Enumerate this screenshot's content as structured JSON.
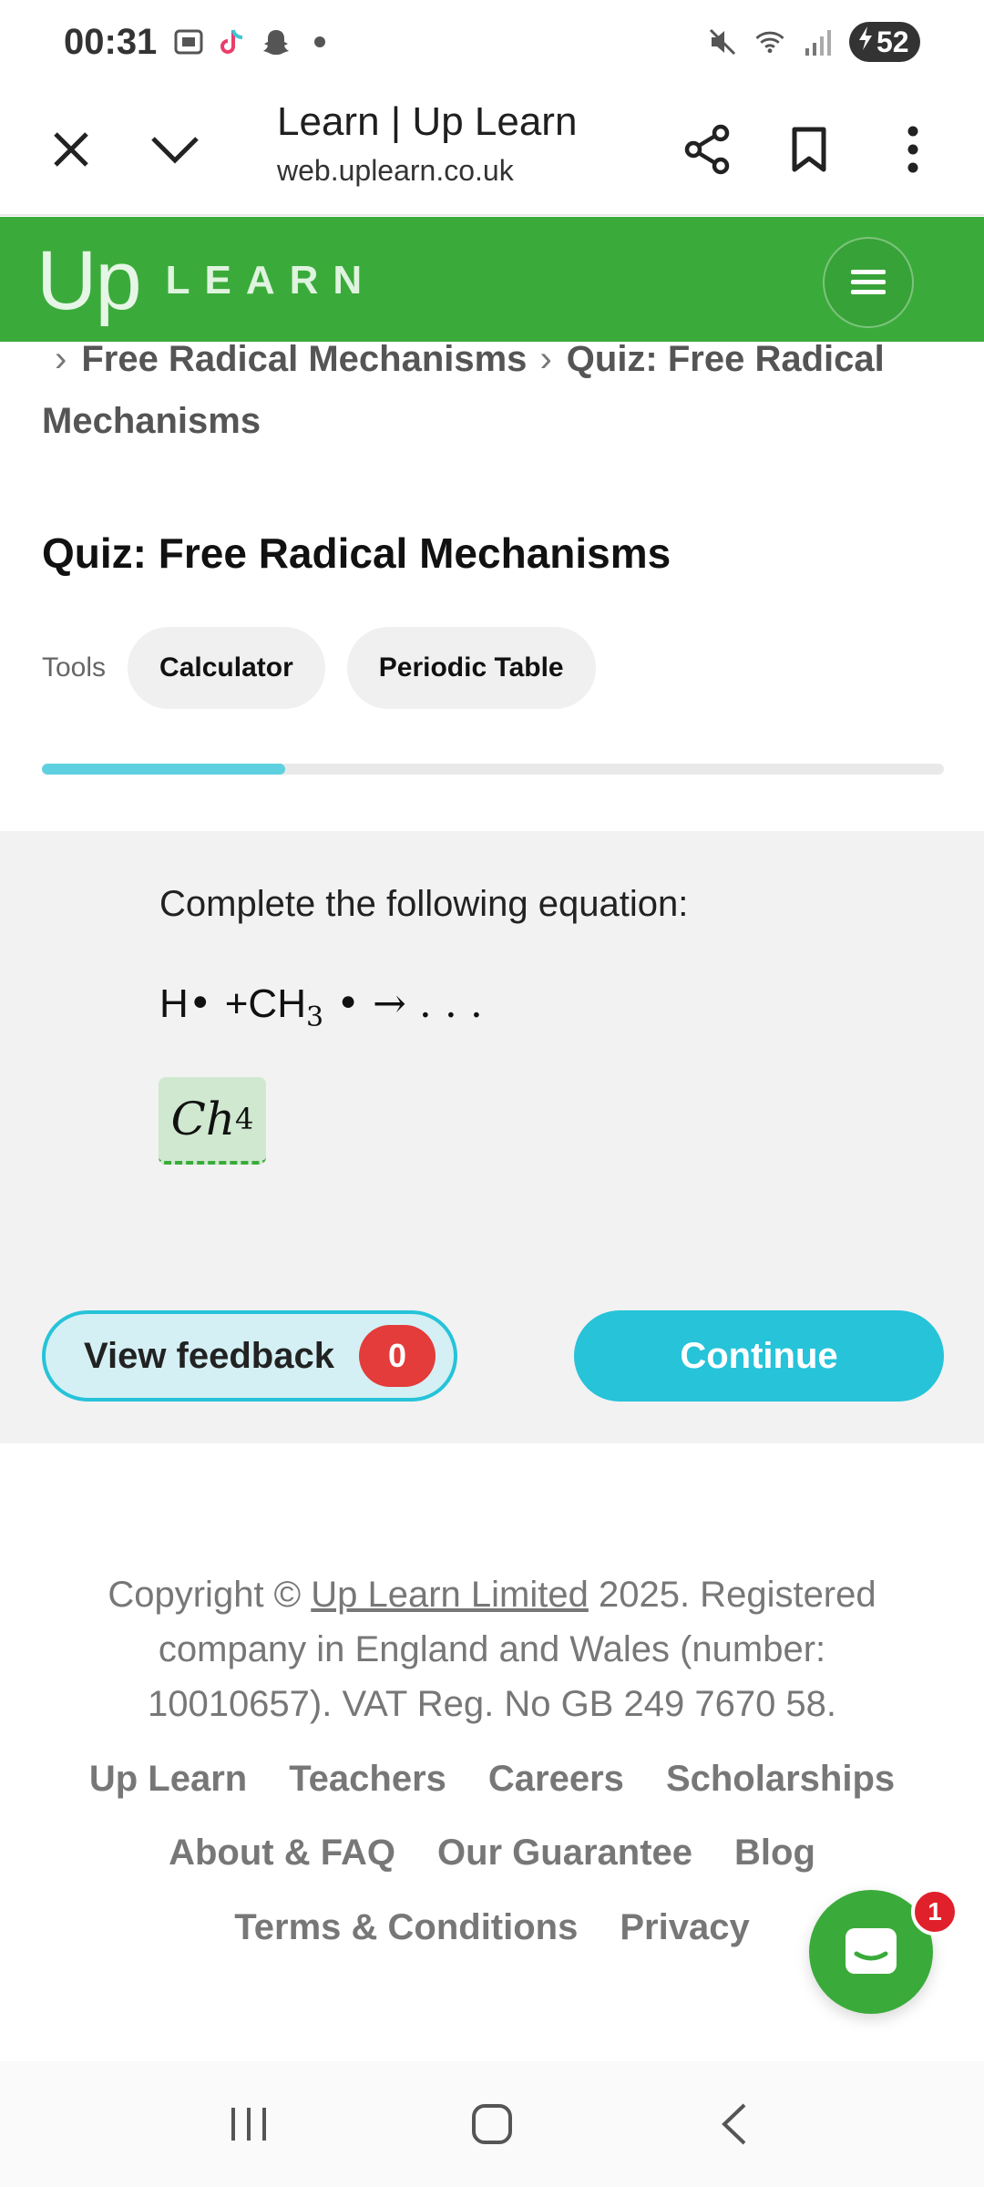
{
  "status_bar": {
    "time": "00:31",
    "battery": "52",
    "icons": [
      "gallery-icon",
      "tiktok-icon",
      "snapchat-icon",
      "dot-icon",
      "mute-icon",
      "wifi-icon",
      "signal-icon",
      "battery-charging-icon"
    ]
  },
  "browser": {
    "title": "Learn | Up Learn",
    "url": "web.uplearn.co.uk"
  },
  "header": {
    "logo_up": "Up",
    "logo_learn": "LEARN"
  },
  "breadcrumb": {
    "items": [
      "Free Radical Mechanisms",
      "Quiz: Free Radical Mechanisms"
    ]
  },
  "page_title": "Quiz: Free Radical Mechanisms",
  "tools": {
    "label": "Tools",
    "buttons": [
      "Calculator",
      "Periodic Table"
    ]
  },
  "progress": {
    "fraction": 0.27
  },
  "question": {
    "prompt": "Complete the following equation:",
    "equation": {
      "h": "H",
      "plus": "+CH",
      "sub": "3",
      "tail": "→ . . .",
      "dot": "•"
    },
    "answer": {
      "main": "Ch",
      "sub": "4"
    }
  },
  "actions": {
    "feedback_label": "View feedback",
    "feedback_count": "0",
    "continue_label": "Continue"
  },
  "footer": {
    "copy_prefix": "Copyright © ",
    "copy_link": "Up Learn Limited",
    "copy_suffix": " 2025. Registered company in England and Wales (number: 10010657). VAT Reg. No GB 249 7670 58.",
    "links_row1": [
      "Up Learn",
      "Teachers",
      "Careers",
      "Scholarships"
    ],
    "links_row2": [
      "About & FAQ",
      "Our Guarantee",
      "Blog"
    ],
    "links_row3": [
      "Terms & Conditions",
      "Privacy"
    ]
  },
  "chat": {
    "badge": "1"
  }
}
